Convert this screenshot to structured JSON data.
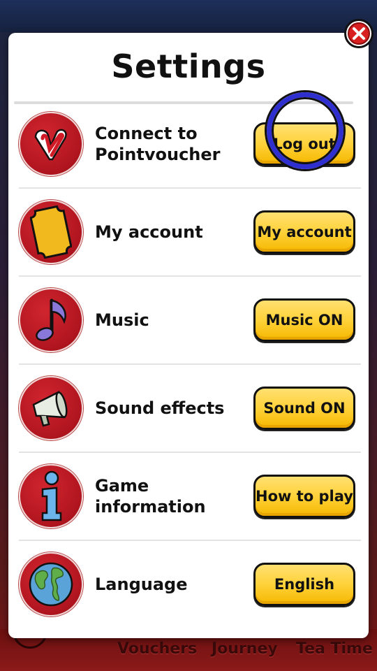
{
  "page": {
    "title": "Settings"
  },
  "background_nav": [
    "Vouchers",
    "Journey",
    "Tea Time"
  ],
  "settings": [
    {
      "label": "Connect to Pointvoucher",
      "line1": "Connect to",
      "line2": "Pointvoucher",
      "button": "Log out",
      "icon": "pointvoucher-logo-icon"
    },
    {
      "label": "My account",
      "button": "My account",
      "icon": "ticket-icon"
    },
    {
      "label": "Music",
      "button": "Music ON",
      "icon": "music-note-icon"
    },
    {
      "label": "Sound effects",
      "button": "Sound ON",
      "icon": "megaphone-icon"
    },
    {
      "label": "Game information",
      "line1": "Game",
      "line2": "information",
      "button": "How to play",
      "icon": "info-icon"
    },
    {
      "label": "Language",
      "button": "English",
      "icon": "globe-icon"
    }
  ],
  "colors": {
    "button": "#ffd23a",
    "icon_bg": "#c01d27",
    "highlight": "#2f2fd0",
    "close": "#d92020"
  }
}
